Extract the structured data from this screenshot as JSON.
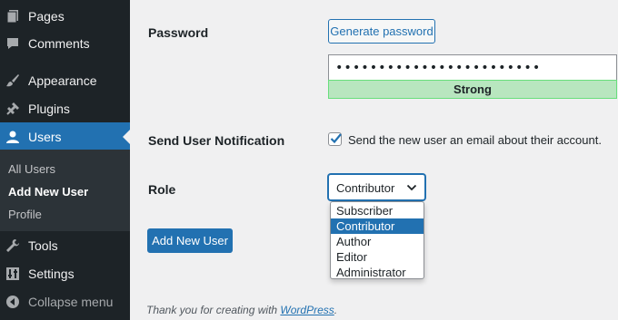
{
  "sidebar": {
    "items": [
      {
        "label": "Pages",
        "icon": "pages-icon"
      },
      {
        "label": "Comments",
        "icon": "comment-icon"
      },
      {
        "label": "Appearance",
        "icon": "paintbrush-icon"
      },
      {
        "label": "Plugins",
        "icon": "plugin-icon"
      },
      {
        "label": "Users",
        "icon": "user-icon"
      },
      {
        "label": "Tools",
        "icon": "wrench-icon"
      },
      {
        "label": "Settings",
        "icon": "settings-icon"
      },
      {
        "label": "Collapse menu",
        "icon": "collapse-icon"
      }
    ],
    "submenu": [
      "All Users",
      "Add New User",
      "Profile"
    ],
    "active": "Users",
    "current_submenu": "Add New User"
  },
  "form": {
    "password_label": "Password",
    "generate_password": "Generate password",
    "password_value": "••••••••••••••••••••••••",
    "strength": "Strong",
    "notification_label": "Send User Notification",
    "notification_text": "Send the new user an email about their account.",
    "notification_checked": true,
    "role_label": "Role",
    "role_selected": "Contributor",
    "role_options": [
      "Subscriber",
      "Contributor",
      "Author",
      "Editor",
      "Administrator"
    ],
    "submit": "Add New User"
  },
  "footer": {
    "prefix": "Thank you for creating with ",
    "link": "WordPress",
    "suffix": "."
  },
  "colors": {
    "sidebar_bg": "#1d2327",
    "accent": "#2271b1",
    "strength_bg": "#b8e6bf"
  }
}
